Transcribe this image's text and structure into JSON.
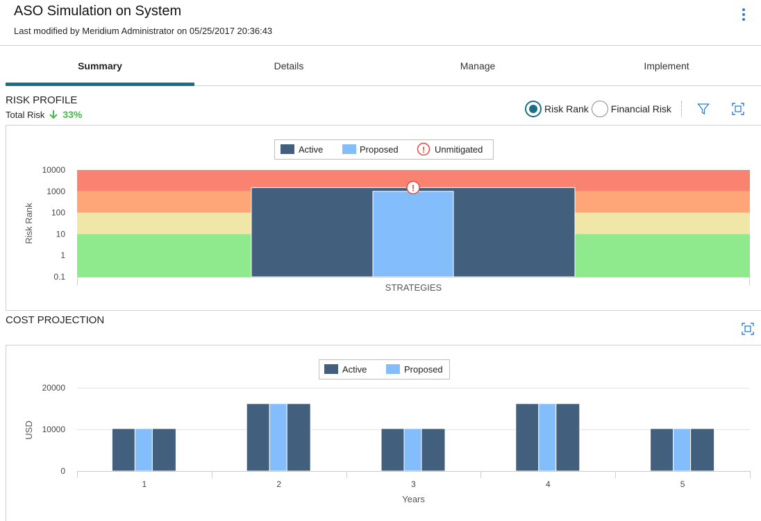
{
  "header": {
    "title": "ASO Simulation on System",
    "subtitle": "Last modified by Meridium Administrator on 05/25/2017 20:36:43",
    "menu_icon": "kebab-menu-icon"
  },
  "tabs": [
    {
      "label": "Summary",
      "active": true
    },
    {
      "label": "Details",
      "active": false
    },
    {
      "label": "Manage",
      "active": false
    },
    {
      "label": "Implement",
      "active": false
    }
  ],
  "risk_profile": {
    "title": "RISK PROFILE",
    "total_risk_label": "Total Risk",
    "total_risk_value": "33%",
    "trend_icon": "arrow-down-icon",
    "radio_options": [
      {
        "label": "Risk Rank",
        "selected": true
      },
      {
        "label": "Financial Risk",
        "selected": false
      }
    ],
    "filter_icon": "filter-icon",
    "expand_icon": "expand-icon"
  },
  "cost_projection": {
    "title": "COST PROJECTION",
    "expand_icon": "expand-icon"
  },
  "colors": {
    "active": "#435f7e",
    "proposed": "#84bdfb",
    "unmitigated": "#e8473c",
    "band_red": "#fa8270",
    "band_orange": "#ffa679",
    "band_yellow": "#efe6a8",
    "band_green": "#8fe98d",
    "accent": "#16708a",
    "positive": "#3fbe45"
  },
  "chart_data": [
    {
      "type": "bar",
      "ylabel": "Risk Rank",
      "xlabel": "",
      "scale": "log",
      "y_ticks": [
        "0.1",
        "1",
        "10",
        "100",
        "1000",
        "10000"
      ],
      "ylim": [
        0.1,
        10000
      ],
      "categories": [
        "STRATEGIES"
      ],
      "legend": [
        "Active",
        "Proposed",
        "Unmitigated"
      ],
      "risk_bands": [
        {
          "color": "green",
          "from": 0.1,
          "to": 10
        },
        {
          "color": "yellow",
          "from": 10,
          "to": 100
        },
        {
          "color": "orange",
          "from": 100,
          "to": 1000
        },
        {
          "color": "red",
          "from": 1000,
          "to": 10000
        }
      ],
      "series": [
        {
          "name": "Active",
          "values": [
            1500
          ]
        },
        {
          "name": "Proposed",
          "values": [
            1000
          ]
        }
      ],
      "unmitigated_marker_value": 1500
    },
    {
      "type": "bar",
      "ylabel": "USD",
      "xlabel": "Years",
      "y_ticks": [
        "0",
        "10000",
        "20000"
      ],
      "ylim": [
        0,
        22000
      ],
      "categories": [
        "1",
        "2",
        "3",
        "4",
        "5"
      ],
      "legend": [
        "Active",
        "Proposed"
      ],
      "series": [
        {
          "name": "Active",
          "values": [
            10200,
            16200,
            10200,
            16200,
            10200
          ]
        },
        {
          "name": "Proposed",
          "values": [
            10200,
            16200,
            10200,
            16200,
            10200
          ]
        }
      ]
    }
  ]
}
